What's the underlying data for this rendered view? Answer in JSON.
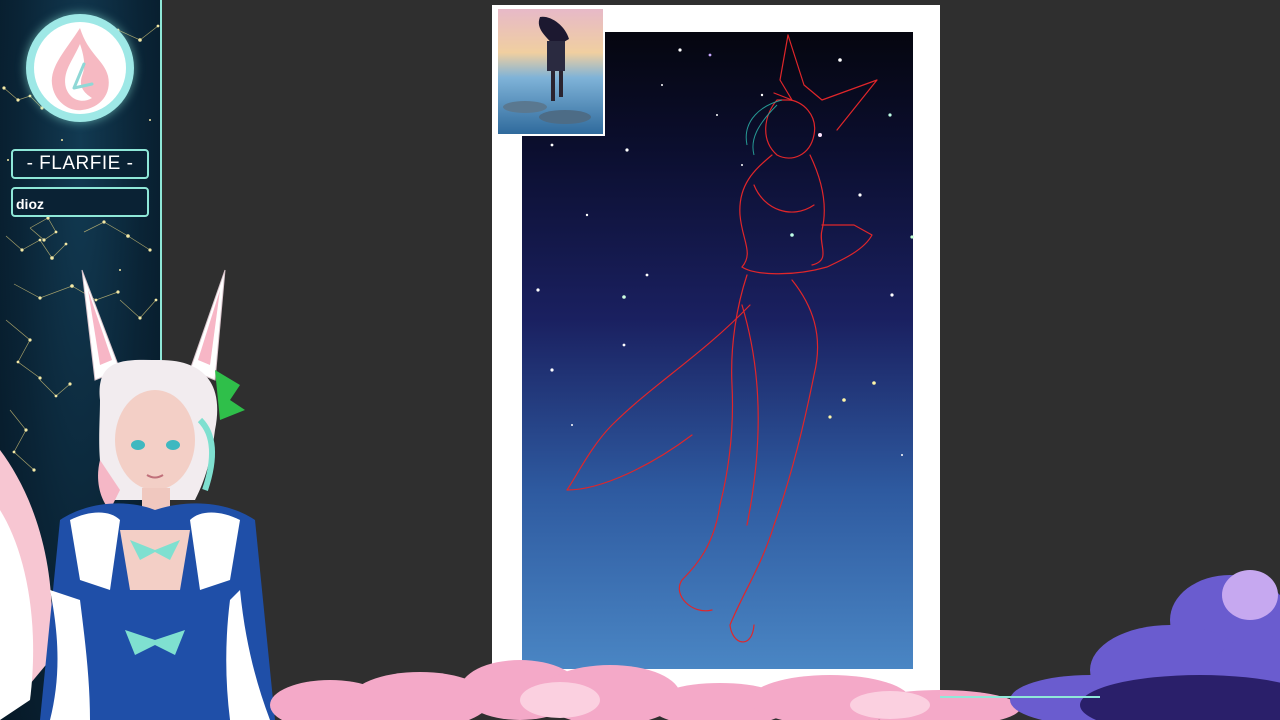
{
  "overlay": {
    "streamer_name": "- FLARFIE -",
    "chat_text": "dioz"
  },
  "icons": {
    "logo": "flame-drop-logo-icon"
  },
  "colors": {
    "panel_bg": "#0a2436",
    "panel_border": "#8fe8d8",
    "workspace_bg": "#2f2f2f",
    "sketch_line": "#e0262a",
    "sky_top": "#05060f",
    "sky_mid": "#1a2060",
    "sky_bottom": "#4a86c4"
  }
}
